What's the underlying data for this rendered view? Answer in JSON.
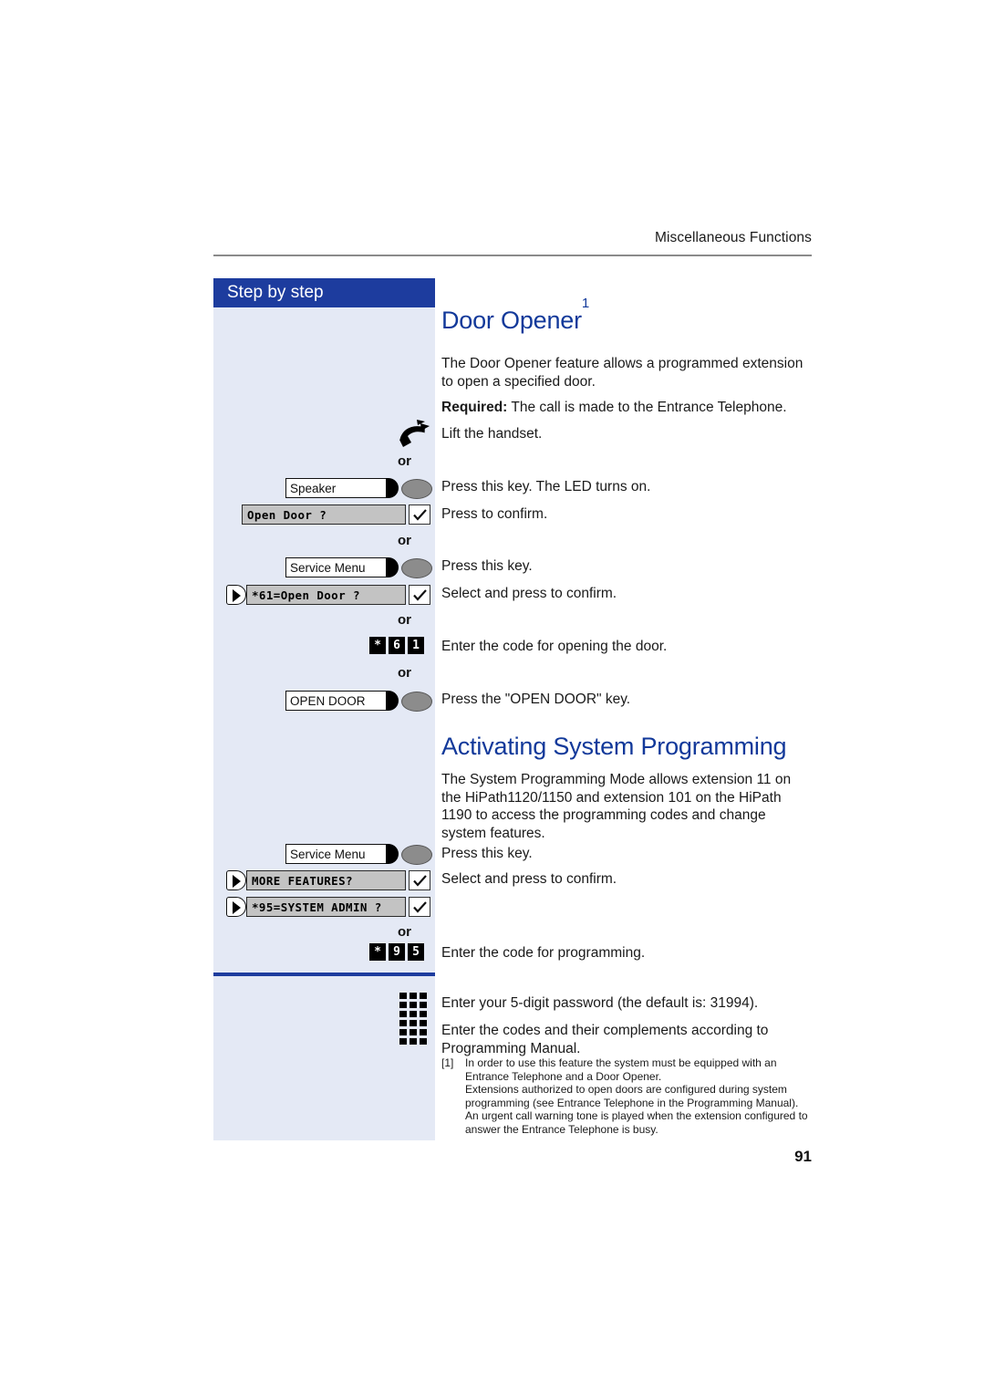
{
  "page": {
    "running_header": "Miscellaneous Functions",
    "page_number": "91",
    "accent_blue": "#12399a",
    "title_bar_blue": "#1d3c9e",
    "sidebar_bg": "#e4e9f5"
  },
  "sidebar": {
    "title": "Step by step"
  },
  "sections": [
    {
      "heading": "Door Opener",
      "heading_footnote_mark": "1",
      "intro": "The Door Opener feature allows a programmed extension to open a specified door.",
      "required_label": "Required:",
      "required_text": "The call is made to the Entrance Telephone."
    },
    {
      "heading": "Activating System Programming",
      "intro": "The System Programming Mode allows extension 11 on the HiPath1120/1150 and extension 101 on the HiPath 1190 to access the programming codes and change system features."
    }
  ],
  "or_label": "or",
  "steps": {
    "lift_handset": {
      "icon": "handset-lifted-icon",
      "text": "Lift the handset."
    },
    "speaker_key": {
      "key_label": "Speaker",
      "icon": "speaker-key-icon",
      "text": "Press this key. The LED turns on."
    },
    "open_door_display": {
      "display": "Open Door ?",
      "confirm_icon": "checkmark-icon",
      "text": "Press to confirm."
    },
    "service_menu_key_1": {
      "key_label": "Service Menu",
      "icon": "service-menu-key-icon",
      "text": "Press this key."
    },
    "open_door_code_display": {
      "select_icon": "select-arrow-icon",
      "display": "*61=Open Door ?",
      "confirm_icon": "checkmark-icon",
      "text": "Select and press to confirm."
    },
    "open_door_digits": {
      "keys": [
        "*",
        "6",
        "1"
      ],
      "text": "Enter the code for opening the door."
    },
    "open_door_key": {
      "key_label": "OPEN DOOR",
      "icon": "open-door-key-icon",
      "text": "Press the \"OPEN DOOR\" key."
    },
    "service_menu_key_2": {
      "key_label": "Service Menu",
      "icon": "service-menu-key-icon",
      "text": "Press this key."
    },
    "more_features_display": {
      "select_icon": "select-arrow-icon",
      "display": "MORE FEATURES?",
      "confirm_icon": "checkmark-icon",
      "text": "Select and press to confirm."
    },
    "system_admin_display": {
      "select_icon": "select-arrow-icon",
      "display": "*95=SYSTEM ADMIN ?",
      "confirm_icon": "checkmark-icon",
      "text": ""
    },
    "system_admin_digits": {
      "keys": [
        "*",
        "9",
        "5"
      ],
      "text": "Enter the code for programming."
    },
    "password_entry": {
      "icon": "dialpad-icon",
      "text": "Enter your 5-digit password (the default is:  31994)."
    },
    "codes_entry": {
      "icon": "dialpad-icon",
      "text": "Enter the codes and their complements according to Programming Manual."
    }
  },
  "footnote": {
    "mark": "[1]",
    "lines": [
      "In order to use this feature the system must be equipped with an Entrance Telephone and a Door Opener.",
      "Extensions authorized to open doors are configured during system programming (see Entrance Telephone in the Programming Manual).",
      "An urgent call warning tone is played when the extension configured to answer the Entrance Telephone is busy."
    ]
  }
}
